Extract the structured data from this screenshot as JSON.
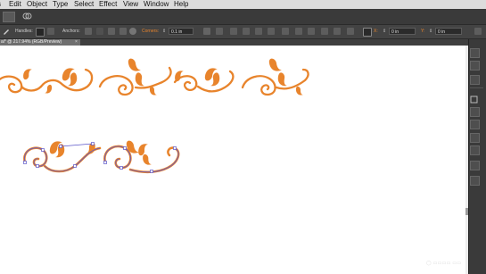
{
  "menu": {
    "items": [
      {
        "label": "Edit"
      },
      {
        "label": "Object"
      },
      {
        "label": "Type"
      },
      {
        "label": "Select"
      },
      {
        "label": "Effect"
      },
      {
        "label": "View"
      },
      {
        "label": "Window"
      },
      {
        "label": "Help"
      }
    ]
  },
  "controlbar": {
    "handles_label": "Handles:",
    "anchors_label": "Anchors:",
    "corners_label": "Corners:",
    "corners_value": "0.1 in",
    "x_value": "0 in",
    "y_value": "0 in"
  },
  "document": {
    "tab_title": "ai* @ 217.94% (RGB/Preview)"
  },
  "colors": {
    "ornament": "#e8842c",
    "selection": "#5b55c9"
  }
}
